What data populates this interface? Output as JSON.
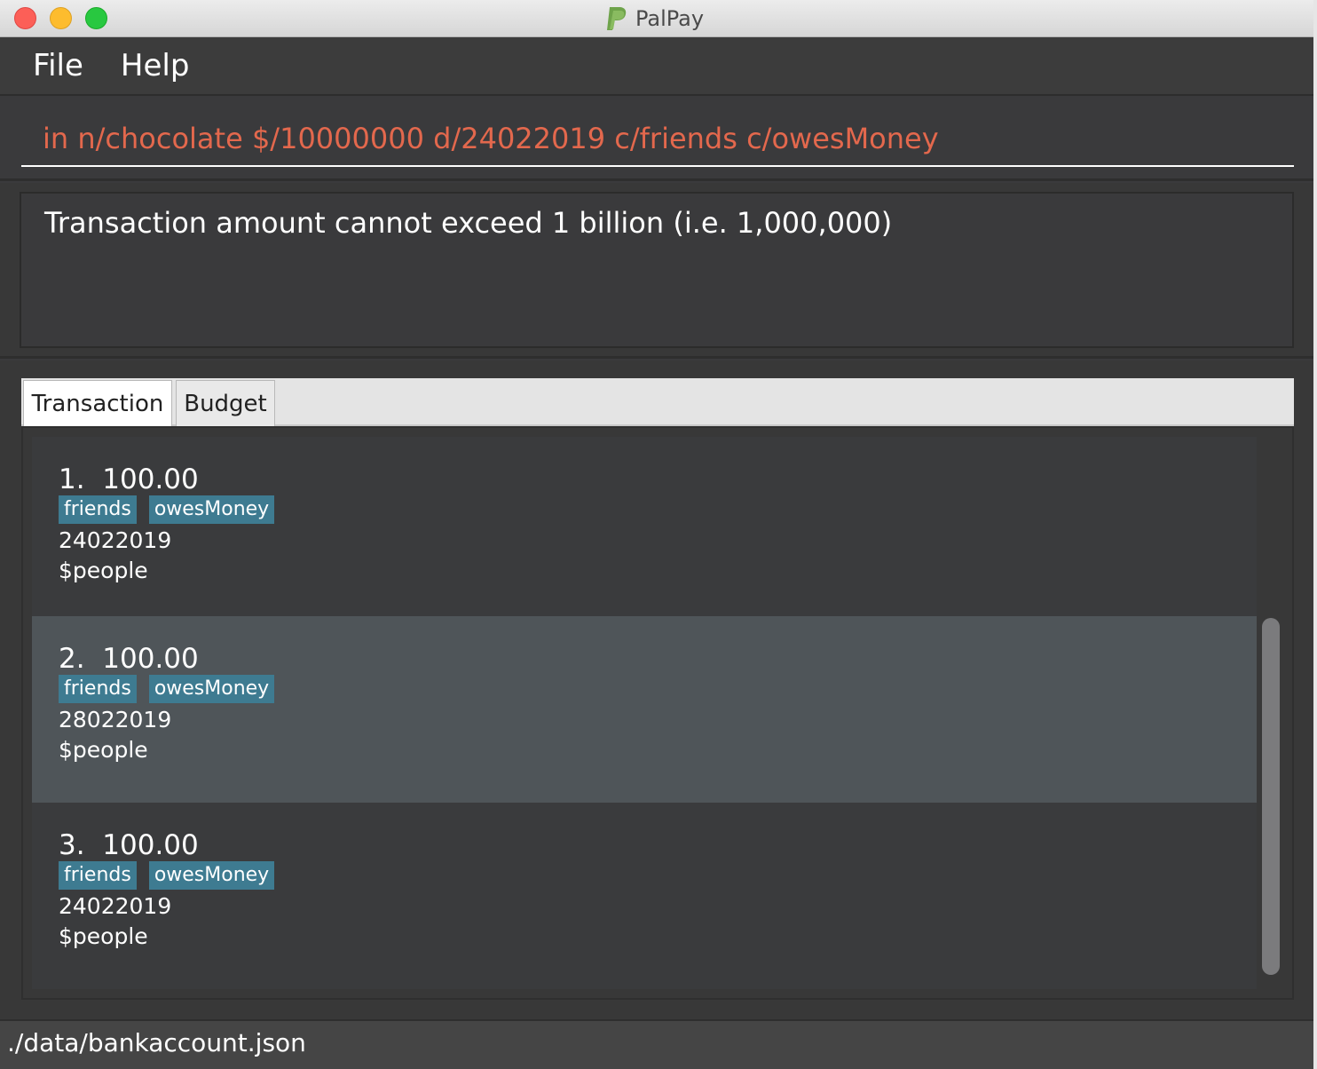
{
  "window": {
    "title": "PalPay",
    "icon": "paypal-logo-icon"
  },
  "menu": {
    "items": [
      {
        "label": "File"
      },
      {
        "label": "Help"
      }
    ]
  },
  "command": {
    "value": "in n/chocolate $/10000000 d/24022019 c/friends c/owesMoney",
    "color": "#e3684d"
  },
  "result": {
    "message": "Transaction amount cannot exceed 1 billion (i.e. 1,000,000)"
  },
  "tabs": [
    {
      "label": "Transaction",
      "active": true
    },
    {
      "label": "Budget",
      "active": false
    }
  ],
  "transactions": [
    {
      "title": "1.  100.00",
      "tags": [
        "friends",
        "owesMoney"
      ],
      "date": "24022019",
      "description": "$people",
      "selected": false
    },
    {
      "title": "2.  100.00",
      "tags": [
        "friends",
        "owesMoney"
      ],
      "date": "28022019",
      "description": "$people",
      "selected": true
    },
    {
      "title": "3.  100.00",
      "tags": [
        "friends",
        "owesMoney"
      ],
      "date": "24022019",
      "description": "$people",
      "selected": false
    }
  ],
  "status": {
    "path": "./data/bankaccount.json"
  },
  "colors": {
    "tag_bg": "#3e7b91",
    "selected_row": "#4f5559",
    "background": "#3a3a3c"
  }
}
